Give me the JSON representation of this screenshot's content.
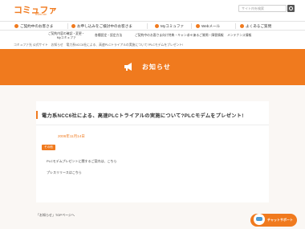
{
  "header": {
    "logo": "コミュファ",
    "logo_sub": "from ctc",
    "search_placeholder": "サイト内を検索"
  },
  "main_nav": {
    "items": [
      {
        "label": "ご契約中のお客さま"
      },
      {
        "label": "お申し込みをご検討中のお客さま"
      },
      {
        "label": "Myコミュファ"
      },
      {
        "label": "Webメール"
      },
      {
        "label": "よくあるご質問"
      }
    ]
  },
  "sub_nav": {
    "items": [
      {
        "label1": "ご契約内容の確認・変更・",
        "label2": "Myコミュファ"
      },
      {
        "label1": "各種設定・設定方法",
        "label2": ""
      },
      {
        "label1": "ご契約中のお客さま向け特典・キャンペーン",
        "label2": ""
      },
      {
        "label1": "よくあるご質問・障害情報",
        "label2": ""
      },
      {
        "label1": "メンテナンス情報",
        "label2": ""
      }
    ]
  },
  "breadcrumb": "コミュファ光 公式サイト　お知らせ　電力系NCC6社による、高速PLCトライアルの実施について?PLCモデムをプレゼント!",
  "banner": {
    "title": "お知らせ"
  },
  "article": {
    "title": "電力系NCC6社による、高速PLCトライアルの実施について?PLCモデムをプレゼント!",
    "date": "2006年11月14日",
    "badge": "その他",
    "lines": [
      "PLCモデムプレゼントに関するご案内は、こちら",
      "プレスリリースはこちら"
    ]
  },
  "footer": {
    "back_link": "「お知らせ」TOPページへ",
    "chatbot_label": "チャットサポート"
  },
  "colors": {
    "accent": "#f07a1e",
    "page_bg": "#faf7f4"
  }
}
